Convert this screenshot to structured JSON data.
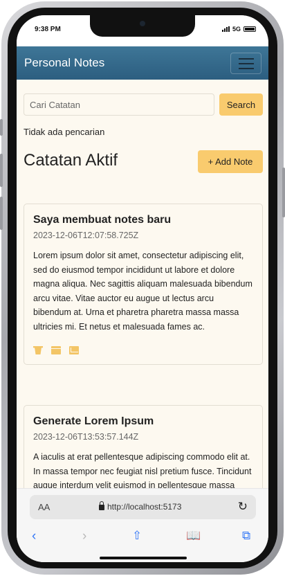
{
  "status": {
    "time": "9:38 PM",
    "network": "5G"
  },
  "navbar": {
    "brand": "Personal Notes"
  },
  "search": {
    "placeholder": "Cari Catatan",
    "button_label": "Search",
    "empty_text": "Tidak ada pencarian"
  },
  "section": {
    "title": "Catatan Aktif",
    "add_label": "+ Add Note"
  },
  "notes": [
    {
      "title": "Saya membuat notes baru",
      "date": "2023-12-06T12:07:58.725Z",
      "body": "Lorem ipsum dolor sit amet, consectetur adipiscing elit, sed do eiusmod tempor incididunt ut labore et dolore magna aliqua. Nec sagittis aliquam malesuada bibendum arcu vitae. Vitae auctor eu augue ut lectus arcu bibendum at. Urna et pharetra pharetra massa massa ultricies mi. Et netus et malesuada fames ac."
    },
    {
      "title": "Generate Lorem Ipsum",
      "date": "2023-12-06T13:53:57.144Z",
      "body": "A iaculis at erat pellentesque adipiscing commodo elit at. In massa tempor nec feugiat nisl pretium fusce. Tincidunt augue interdum velit euismod in pellentesque massa placerat."
    }
  ],
  "browser": {
    "aa_label": "AA",
    "url": "http://localhost:5173",
    "reload_icon": "reload-icon"
  },
  "colors": {
    "navbar": "#2f6485",
    "accent": "#f9cb6e",
    "background": "#fdf9f0",
    "link": "#3478f6"
  }
}
